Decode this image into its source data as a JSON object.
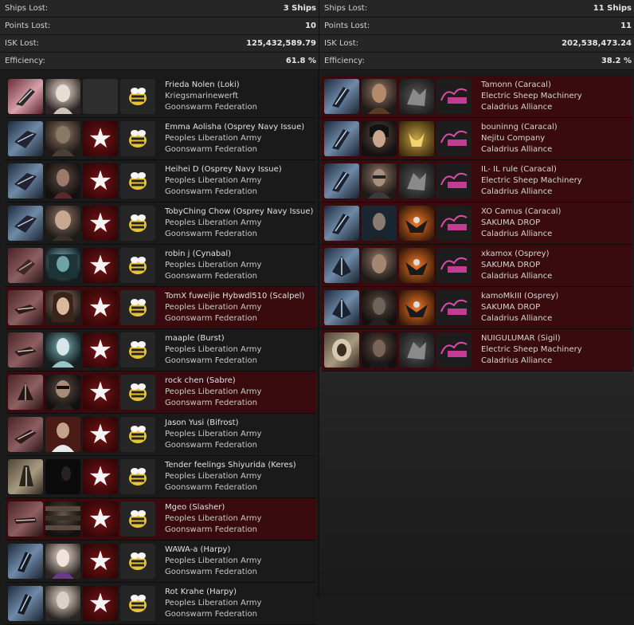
{
  "left": {
    "stats": [
      {
        "label": "Ships Lost:",
        "value": "3 Ships"
      },
      {
        "label": "Points Lost:",
        "value": "10"
      },
      {
        "label": "ISK Lost:",
        "value": "125,432,589.79"
      },
      {
        "label": "Efficiency:",
        "value": "61.8 %"
      }
    ],
    "rows": [
      {
        "name": "Frieda Nolen (Loki)",
        "corp": "Kriegsmarinewerft",
        "alliance": "Goonswarm Federation"
      },
      {
        "name": "Emma Aolisha (Osprey Navy Issue)",
        "corp": "Peoples Liberation Army",
        "alliance": "Goonswarm Federation"
      },
      {
        "name": "Heihei D (Osprey Navy Issue)",
        "corp": "Peoples Liberation Army",
        "alliance": "Goonswarm Federation"
      },
      {
        "name": "TobyChing Chow (Osprey Navy Issue)",
        "corp": "Peoples Liberation Army",
        "alliance": "Goonswarm Federation"
      },
      {
        "name": "robin j (Cynabal)",
        "corp": "Peoples Liberation Army",
        "alliance": "Goonswarm Federation"
      },
      {
        "name": "TomX fuweijie Hybwdl510 (Scalpel)",
        "corp": "Peoples Liberation Army",
        "alliance": "Goonswarm Federation"
      },
      {
        "name": "maaple (Burst)",
        "corp": "Peoples Liberation Army",
        "alliance": "Goonswarm Federation"
      },
      {
        "name": "rock chen (Sabre)",
        "corp": "Peoples Liberation Army",
        "alliance": "Goonswarm Federation"
      },
      {
        "name": "Jason Yusi (Bifrost)",
        "corp": "Peoples Liberation Army",
        "alliance": "Goonswarm Federation"
      },
      {
        "name": "Tender feelings Shiyurida (Keres)",
        "corp": "Peoples Liberation Army",
        "alliance": "Goonswarm Federation"
      },
      {
        "name": "Mgeo (Slasher)",
        "corp": "Peoples Liberation Army",
        "alliance": "Goonswarm Federation"
      },
      {
        "name": "WAWA-a (Harpy)",
        "corp": "Peoples Liberation Army",
        "alliance": "Goonswarm Federation"
      },
      {
        "name": "Rot Krahe (Harpy)",
        "corp": "Peoples Liberation Army",
        "alliance": "Goonswarm Federation"
      }
    ]
  },
  "right": {
    "stats": [
      {
        "label": "Ships Lost:",
        "value": "11 Ships"
      },
      {
        "label": "Points Lost:",
        "value": "11"
      },
      {
        "label": "ISK Lost:",
        "value": "202,538,473.24"
      },
      {
        "label": "Efficiency:",
        "value": "38.2 %"
      }
    ],
    "rows": [
      {
        "name": "Tamonn (Caracal)",
        "corp": "Electric Sheep Machinery",
        "alliance": "Caladrius Alliance"
      },
      {
        "name": "bouninng (Caracal)",
        "corp": "Nejitu Company",
        "alliance": "Caladrius Alliance"
      },
      {
        "name": "IL- IL rule (Caracal)",
        "corp": "Electric Sheep Machinery",
        "alliance": "Caladrius Alliance"
      },
      {
        "name": "XO Camus (Caracal)",
        "corp": "SAKUMA DROP",
        "alliance": "Caladrius Alliance"
      },
      {
        "name": "xkamox (Osprey)",
        "corp": "SAKUMA DROP",
        "alliance": "Caladrius Alliance"
      },
      {
        "name": "kamoMkIII (Osprey)",
        "corp": "SAKUMA DROP",
        "alliance": "Caladrius Alliance"
      },
      {
        "name": "NUIGULUMAR (Sigil)",
        "corp": "Electric Sheep Machinery",
        "alliance": "Caladrius Alliance"
      }
    ]
  },
  "icons": {
    "corp_star": "★",
    "left_ship": "ship-icon",
    "alliance_left": "bee-icon",
    "alliance_right": "caladrius-logo-icon"
  }
}
